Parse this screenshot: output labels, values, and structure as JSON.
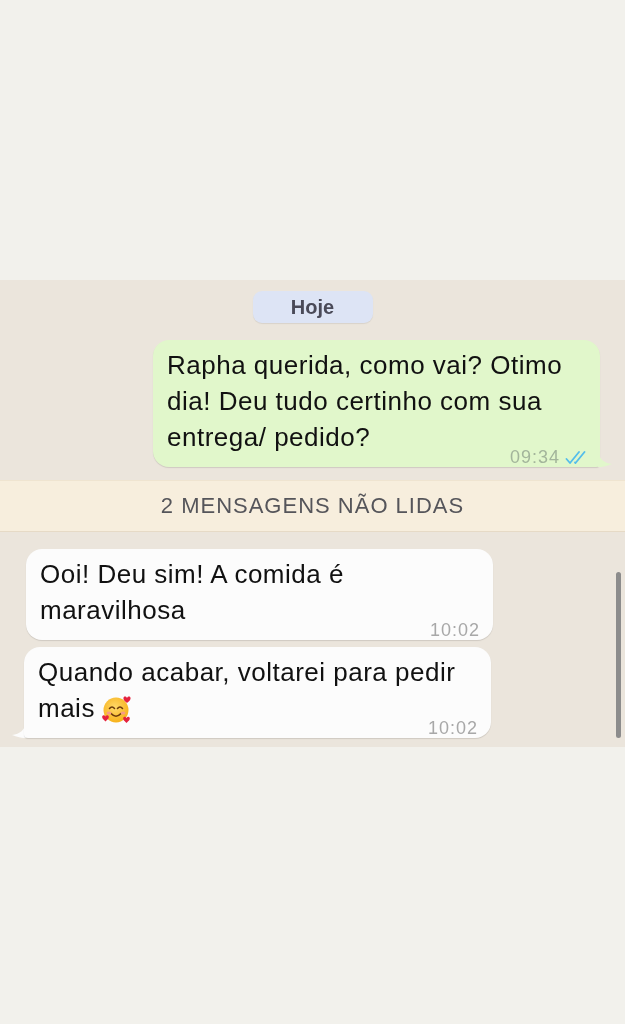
{
  "chat": [
    {
      "kind": "date",
      "text": "Hoje"
    },
    {
      "kind": "outgoing",
      "text": "Rapha querida, como vai? Otimo dia! Deu tudo certinho com sua entrega/ pedido?",
      "time": "09:34",
      "read": true,
      "tail": true,
      "emoji": false
    },
    {
      "kind": "unread",
      "text": "2 MENSAGENS NÃO LIDAS"
    },
    {
      "kind": "incoming",
      "text": "Ooi! Deu sim! A comida é maravilhosa",
      "time": "10:02",
      "tail": false,
      "emoji": false
    },
    {
      "kind": "incoming",
      "text": "Quando acabar, voltarei para pedir mais",
      "time": "10:02",
      "tail": true,
      "emoji": true
    }
  ]
}
